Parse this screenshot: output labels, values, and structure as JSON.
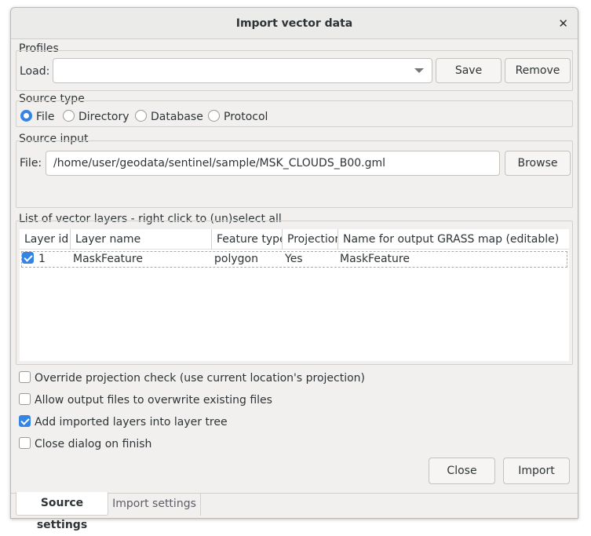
{
  "window": {
    "title": "Import vector data",
    "close": "✕"
  },
  "profiles": {
    "legend": "Profiles",
    "load_label": "Load:",
    "load_value": "",
    "save": "Save",
    "remove": "Remove"
  },
  "source_type": {
    "legend": "Source type",
    "options": [
      {
        "label": "File",
        "selected": true
      },
      {
        "label": "Directory",
        "selected": false
      },
      {
        "label": "Database",
        "selected": false
      },
      {
        "label": "Protocol",
        "selected": false
      }
    ]
  },
  "source_input": {
    "legend": "Source input",
    "file_label": "File:",
    "file_value": "/home/user/geodata/sentinel/sample/MSK_CLOUDS_B00.gml",
    "browse": "Browse"
  },
  "layers": {
    "legend": "List of vector layers - right click to (un)select all",
    "columns": [
      "Layer id",
      "Layer name",
      "Feature type",
      "Projection",
      "Name for output GRASS map (editable)"
    ],
    "rows": [
      {
        "checked": true,
        "id": "1",
        "name": "MaskFeature",
        "type": "polygon",
        "projection": "Yes",
        "output": "MaskFeature"
      }
    ]
  },
  "options": [
    {
      "label": "Override projection check (use current location's projection)",
      "checked": false
    },
    {
      "label": "Allow output files to overwrite existing files",
      "checked": false
    },
    {
      "label": "Add imported layers into layer tree",
      "checked": true
    },
    {
      "label": "Close dialog on finish",
      "checked": false
    }
  ],
  "buttons": {
    "close": "Close",
    "import": "Import"
  },
  "tabs": [
    {
      "label": "Source settings",
      "active": true
    },
    {
      "label": "Import settings",
      "active": false
    }
  ],
  "colors": {
    "accent": "#3584e4"
  }
}
